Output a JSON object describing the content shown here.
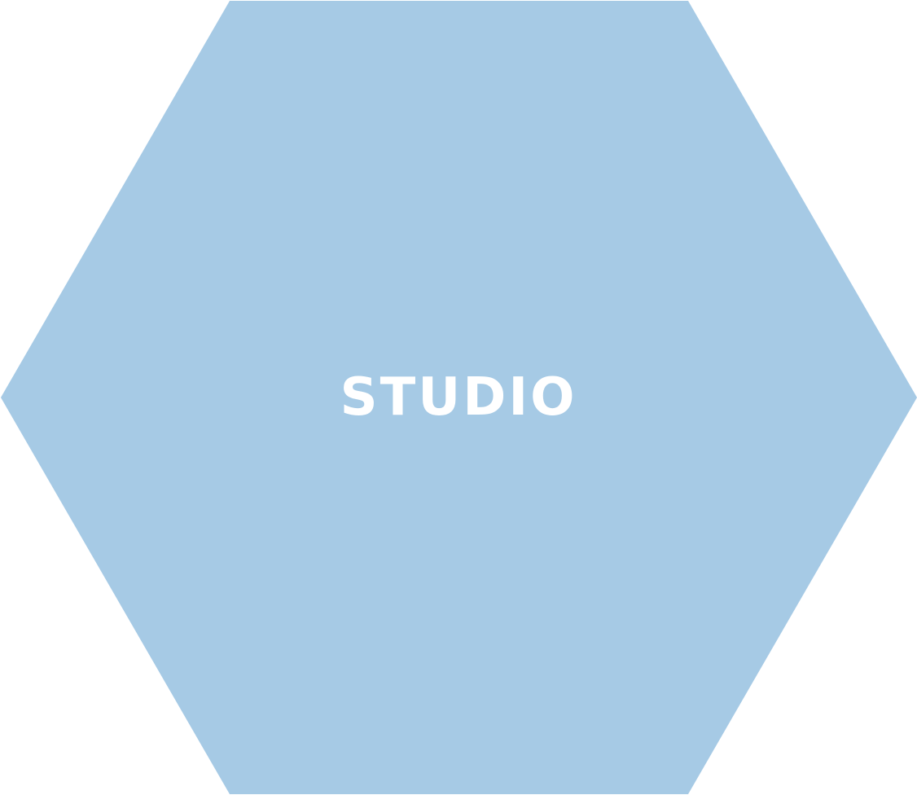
{
  "hexagon": {
    "label": "STUDIO",
    "fill_color": "#a6cae5",
    "text_color": "#ffffff"
  }
}
